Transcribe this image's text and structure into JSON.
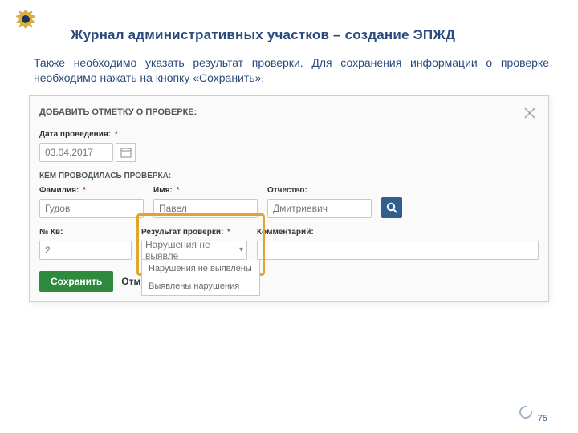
{
  "header": {
    "title": "Журнал административных участков – создание ЭПЖД"
  },
  "intro": "Также необходимо указать результат проверки. Для сохранения информации о проверке необходимо нажать на кнопку «Сохранить».",
  "panel": {
    "title": "ДОБАВИТЬ ОТМЕТКУ О ПРОВЕРКЕ:",
    "date": {
      "label": "Дата проведения:",
      "value": "03.04.2017"
    },
    "who_title": "КЕМ ПРОВОДИЛАСЬ ПРОВЕРКА:",
    "last": {
      "label": "Фамилия:",
      "value": "Гудов"
    },
    "first": {
      "label": "Имя:",
      "value": "Павел"
    },
    "middle": {
      "label": "Отчество:",
      "value": "Дмитриевич"
    },
    "kv": {
      "label": "№ Кв:",
      "value": "2"
    },
    "result": {
      "label": "Результат проверки:",
      "selected": "Нарушения не выявле",
      "options": [
        "Нарушения не выявлены",
        "Выявлены нарушения"
      ]
    },
    "comment": {
      "label": "Комментарий:",
      "value": ""
    },
    "save": "Сохранить",
    "cancel": "Отменить"
  },
  "page_number": "75"
}
